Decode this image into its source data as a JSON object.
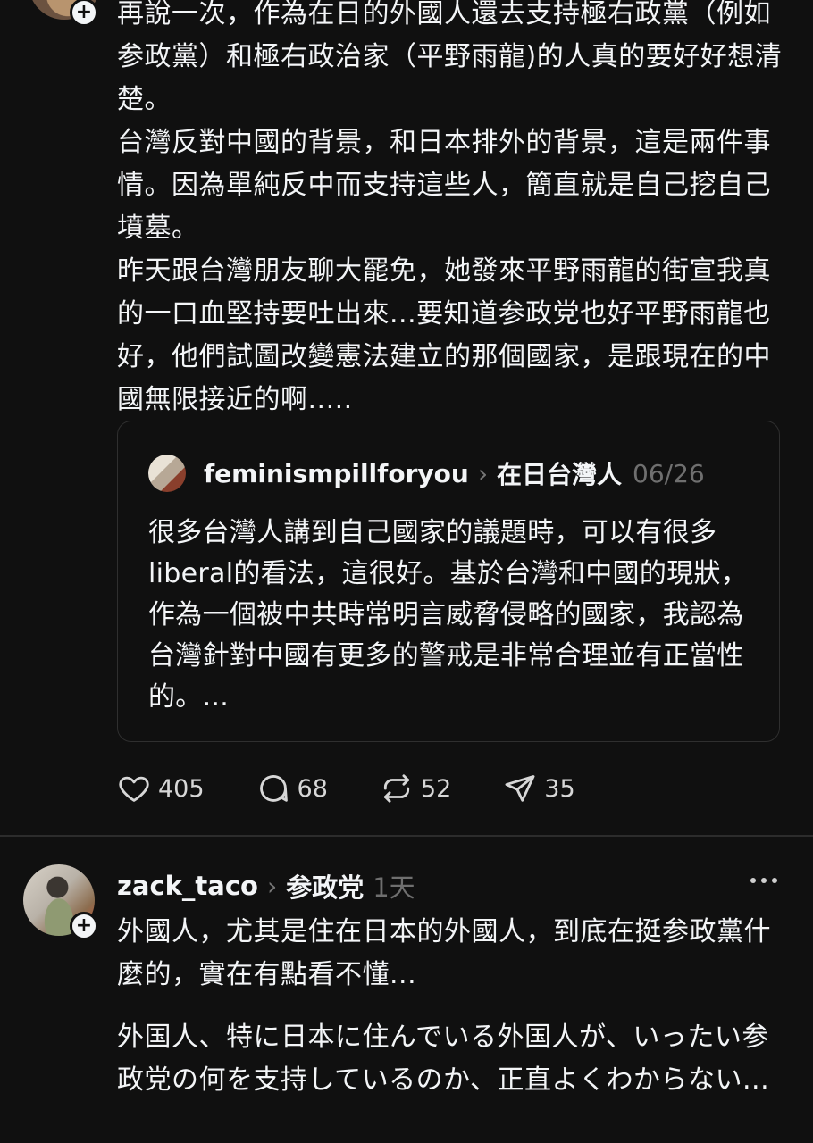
{
  "post1": {
    "paragraphs": [
      "再說一次，作為在日的外國人還去支持極右政黨（例如参政黨）和極右政治家（平野雨龍)的人真的要好好想清楚。",
      "台灣反對中國的背景，和日本排外的背景，這是兩件事情。因為單純反中而支持這些人，簡直就是自己挖自己墳墓。",
      "昨天跟台灣朋友聊大罷免，她發來平野雨龍的街宣我真的一口血堅持要吐出來...要知道参政党也好平野雨龍也好，他們試圖改變憲法建立的那個國家，是跟現在的中國無限接近的啊....."
    ],
    "quote": {
      "username": "feminismpillforyou",
      "topic": "在日台灣人",
      "date": "06/26",
      "text": "很多台灣人講到自己國家的議題時，可以有很多liberal的看法，這很好。基於台灣和中國的現狀，作為一個被中共時常明言威脅侵略的國家，我認為台灣針對中國有更多的警戒是非常合理並有正當性的。..."
    },
    "actions": {
      "likes": "405",
      "comments": "68",
      "reposts": "52",
      "shares": "35"
    }
  },
  "post2": {
    "username": "zack_taco",
    "topic": "参政党",
    "time": "1天",
    "paragraphs": [
      "外國人，尤其是住在日本的外國人，到底在挺参政黨什麼的，實在有點看不懂...",
      "外国人、特に日本に住んでいる外国人が、いったい参政党の何を支持しているのか、正直よくわからない..."
    ]
  },
  "icons": {
    "like": "heart-icon",
    "comment": "comment-bubble-icon",
    "repost": "repost-icon",
    "share": "send-icon",
    "more": "more-dots-icon",
    "follow": "plus-icon"
  }
}
